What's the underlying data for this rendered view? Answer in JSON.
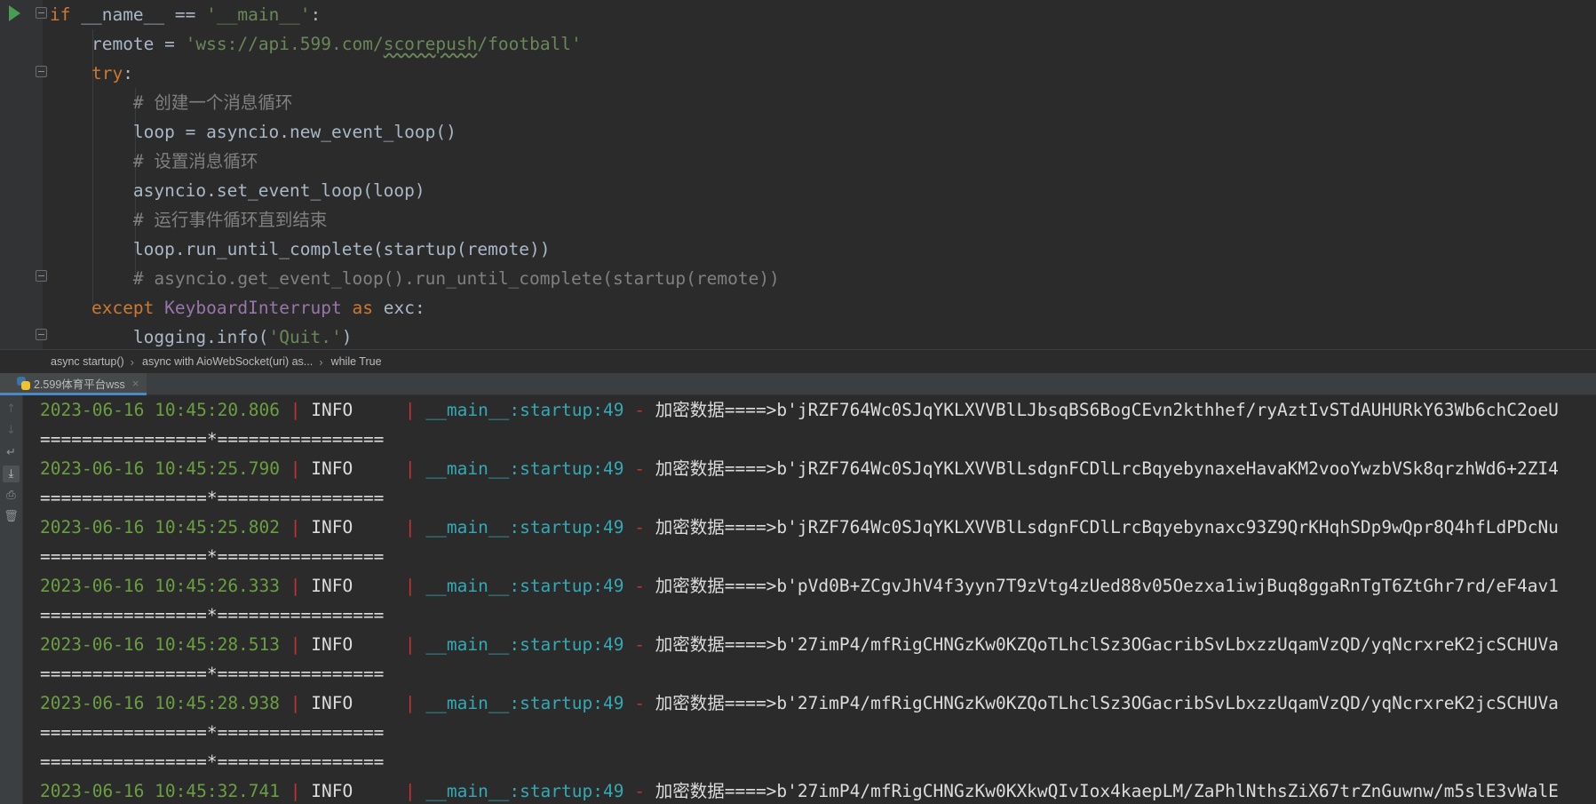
{
  "editor": {
    "lines": [
      {
        "indent": "",
        "tokens": [
          {
            "t": "if ",
            "c": "kw"
          },
          {
            "t": "__name__",
            "c": ""
          },
          {
            "t": " == ",
            "c": ""
          },
          {
            "t": "'__main__'",
            "c": "str"
          },
          {
            "t": ":",
            "c": ""
          }
        ]
      },
      {
        "indent": "    ",
        "tokens": [
          {
            "t": "remote = ",
            "c": ""
          },
          {
            "t": "'wss://api.599.com/",
            "c": "str"
          },
          {
            "t": "scorepush",
            "c": "str squiggle"
          },
          {
            "t": "/football'",
            "c": "str"
          }
        ]
      },
      {
        "indent": "    ",
        "tokens": [
          {
            "t": "try",
            "c": "kw"
          },
          {
            "t": ":",
            "c": ""
          }
        ]
      },
      {
        "indent": "        ",
        "tokens": [
          {
            "t": "# 创建一个消息循环",
            "c": "cm"
          }
        ]
      },
      {
        "indent": "        ",
        "tokens": [
          {
            "t": "loop = asyncio.new_event_loop()",
            "c": ""
          }
        ]
      },
      {
        "indent": "        ",
        "tokens": [
          {
            "t": "# 设置消息循环",
            "c": "cm"
          }
        ]
      },
      {
        "indent": "        ",
        "tokens": [
          {
            "t": "asyncio.set_event_loop(loop)",
            "c": ""
          }
        ]
      },
      {
        "indent": "        ",
        "tokens": [
          {
            "t": "# 运行事件循环直到结束",
            "c": "cm"
          }
        ]
      },
      {
        "indent": "        ",
        "tokens": [
          {
            "t": "loop.run_until_complete(startup(remote))",
            "c": ""
          }
        ]
      },
      {
        "indent": "        ",
        "tokens": [
          {
            "t": "# asyncio.get_event_loop().run_until_complete(startup(remote))",
            "c": "cm"
          }
        ]
      },
      {
        "indent": "    ",
        "tokens": [
          {
            "t": "except ",
            "c": "kw"
          },
          {
            "t": "KeyboardInterrupt",
            "c": "cls"
          },
          {
            "t": " as ",
            "c": "kw"
          },
          {
            "t": "exc:",
            "c": ""
          }
        ]
      },
      {
        "indent": "        ",
        "tokens": [
          {
            "t": "logging.info(",
            "c": ""
          },
          {
            "t": "'Quit.'",
            "c": "str"
          },
          {
            "t": ")",
            "c": ""
          }
        ]
      }
    ]
  },
  "breadcrumb": {
    "items": [
      "async startup()",
      "async with AioWebSocket(uri) as...",
      "while True"
    ]
  },
  "run_tab": {
    "label": "2.599体育平台wss",
    "close": "×"
  },
  "console_toolbar": {
    "icons": [
      "up-arrow-icon",
      "down-arrow-icon",
      "soft-wrap-icon",
      "scroll-to-end-icon",
      "print-icon",
      "trash-icon"
    ]
  },
  "console": {
    "lines": [
      {
        "type": "log",
        "ts": "2023-06-16 10:45:20.806",
        "level": "INFO    ",
        "module": "__main__:startup:49",
        "msg": "加密数据====>b'jRZF764Wc0SJqYKLXVVBlLJbsqBS6BogCEvn2kthhef/ryAztIvSTdAUHURkY63Wb6chC2oeU"
      },
      {
        "type": "sep",
        "text": "================*================"
      },
      {
        "type": "log",
        "ts": "2023-06-16 10:45:25.790",
        "level": "INFO    ",
        "module": "__main__:startup:49",
        "msg": "加密数据====>b'jRZF764Wc0SJqYKLXVVBlLsdgnFCDlLrcBqyebynaxeHavaKM2vooYwzbVSk8qrzhWd6+2ZI4"
      },
      {
        "type": "sep",
        "text": "================*================"
      },
      {
        "type": "log",
        "ts": "2023-06-16 10:45:25.802",
        "level": "INFO    ",
        "module": "__main__:startup:49",
        "msg": "加密数据====>b'jRZF764Wc0SJqYKLXVVBlLsdgnFCDlLrcBqyebynaxc93Z9QrKHqhSDp9wQpr8Q4hfLdPDcNu"
      },
      {
        "type": "sep",
        "text": "================*================"
      },
      {
        "type": "log",
        "ts": "2023-06-16 10:45:26.333",
        "level": "INFO    ",
        "module": "__main__:startup:49",
        "msg": "加密数据====>b'pVd0B+ZCgvJhV4f3yyn7T9zVtg4zUed88v05Oezxa1iwjBuq8ggaRnTgT6ZtGhr7rd/eF4av1"
      },
      {
        "type": "sep",
        "text": "================*================"
      },
      {
        "type": "log",
        "ts": "2023-06-16 10:45:28.513",
        "level": "INFO    ",
        "module": "__main__:startup:49",
        "msg": "加密数据====>b'27imP4/mfRigCHNGzKw0KZQoTLhclSz3OGacribSvLbxzzUqamVzQD/yqNcrxreK2jcSCHUVa"
      },
      {
        "type": "sep",
        "text": "================*================"
      },
      {
        "type": "log",
        "ts": "2023-06-16 10:45:28.938",
        "level": "INFO    ",
        "module": "__main__:startup:49",
        "msg": "加密数据====>b'27imP4/mfRigCHNGzKw0KZQoTLhclSz3OGacribSvLbxzzUqamVzQD/yqNcrxreK2jcSCHUVa"
      },
      {
        "type": "sep",
        "text": "================*================"
      },
      {
        "type": "sep",
        "text": "================*================"
      },
      {
        "type": "log",
        "ts": "2023-06-16 10:45:32.741",
        "level": "INFO    ",
        "module": "__main__:startup:49",
        "msg": "加密数据====>b'27imP4/mfRigCHNGzKw0KXkwQIvIox4kaepLM/ZaPhlNthsZiX67trZnGuwnw/m5slE3vWalE"
      }
    ]
  }
}
